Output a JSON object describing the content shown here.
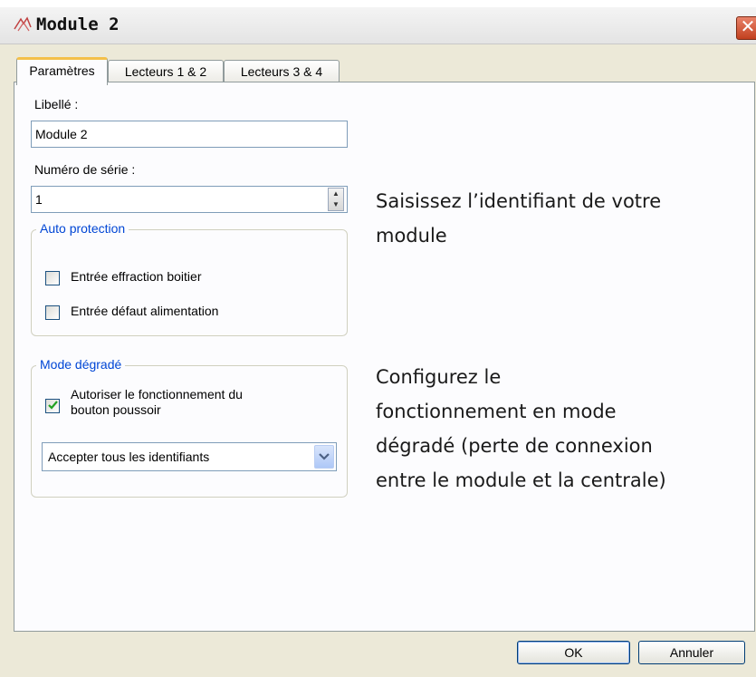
{
  "window": {
    "title": "Module 2",
    "close_glyph": "✕"
  },
  "tabs": [
    {
      "label": "Paramètres",
      "active": true
    },
    {
      "label": "Lecteurs 1 & 2",
      "active": false
    },
    {
      "label": "Lecteurs 3 & 4",
      "active": false
    }
  ],
  "form": {
    "libelle_label": "Libellé :",
    "libelle_value": "Module 2",
    "serie_label": "Numéro de série :",
    "serie_value": "1"
  },
  "auto_protection": {
    "title": "Auto protection",
    "items": [
      {
        "label": "Entrée effraction boitier",
        "checked": false
      },
      {
        "label": "Entrée défaut alimentation",
        "checked": false
      }
    ]
  },
  "mode_degrade": {
    "title": "Mode dégradé",
    "checkbox_line1": "Autoriser le fonctionnement du",
    "checkbox_line2": "bouton poussoir",
    "checkbox_checked": true,
    "select_value": "Accepter tous les identifiants"
  },
  "annotations": {
    "first": [
      "Saisissez l’identifiant de votre",
      "module"
    ],
    "second": [
      "Configurez le",
      "fonctionnement en mode",
      "dégradé (perte de connexion",
      "entre le module et la centrale)"
    ]
  },
  "buttons": {
    "ok": "OK",
    "cancel": "Annuler"
  },
  "colors": {
    "group_title": "#0046d5",
    "check_green": "#21a121",
    "close_red": "#c2401f"
  }
}
